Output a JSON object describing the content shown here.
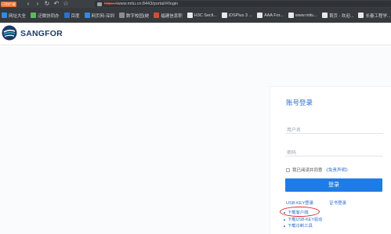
{
  "browser": {
    "badge": "已阻拦截",
    "url_prefix": "https://",
    "url_main": "www.mitu.cn:8443/portal/#/login",
    "bookmarks": [
      {
        "label": "网址大全",
        "color": "#2d8cf0"
      },
      {
        "label": "泛微协同办",
        "color": "#5bb85d"
      },
      {
        "label": "百度",
        "color": "#2f6fd0"
      },
      {
        "label": "网页网-深圳",
        "color": "#3a87d8"
      },
      {
        "label": "数字校园(统",
        "color": "#8a8d91"
      },
      {
        "label": "福建信息职",
        "color": "#d94a38"
      },
      {
        "label": "H3C Secli...",
        "color": "#e8e8e8"
      },
      {
        "label": "iDSPlus 3 ...",
        "color": "#e8e8e8"
      },
      {
        "label": "AAA For...",
        "color": "#e8e8e8"
      },
      {
        "label": "www.mitu...",
        "color": "#e8e8e8"
      },
      {
        "label": "首页 - 欢迎...",
        "color": "#e8e8e8"
      },
      {
        "label": "长春工程学...",
        "color": "#e8e8e8"
      }
    ]
  },
  "header": {
    "brand": "SANGFOR",
    "logo_color": "#1b3a66",
    "logo_accent": "#2aa8c9"
  },
  "login": {
    "title": "账号登录",
    "username_placeholder": "用户名",
    "password_placeholder": "密码",
    "agree_text": "我已阅读并同意",
    "agree_link": "《免责声明》",
    "button": "登录",
    "usb_key_login": "USB-KEY登录",
    "cert_login": "证书登录",
    "downloads": [
      "下载客户端",
      "下载USB-KEY驱动",
      "下载诊断工具"
    ],
    "accent": "#1e7ce6"
  }
}
